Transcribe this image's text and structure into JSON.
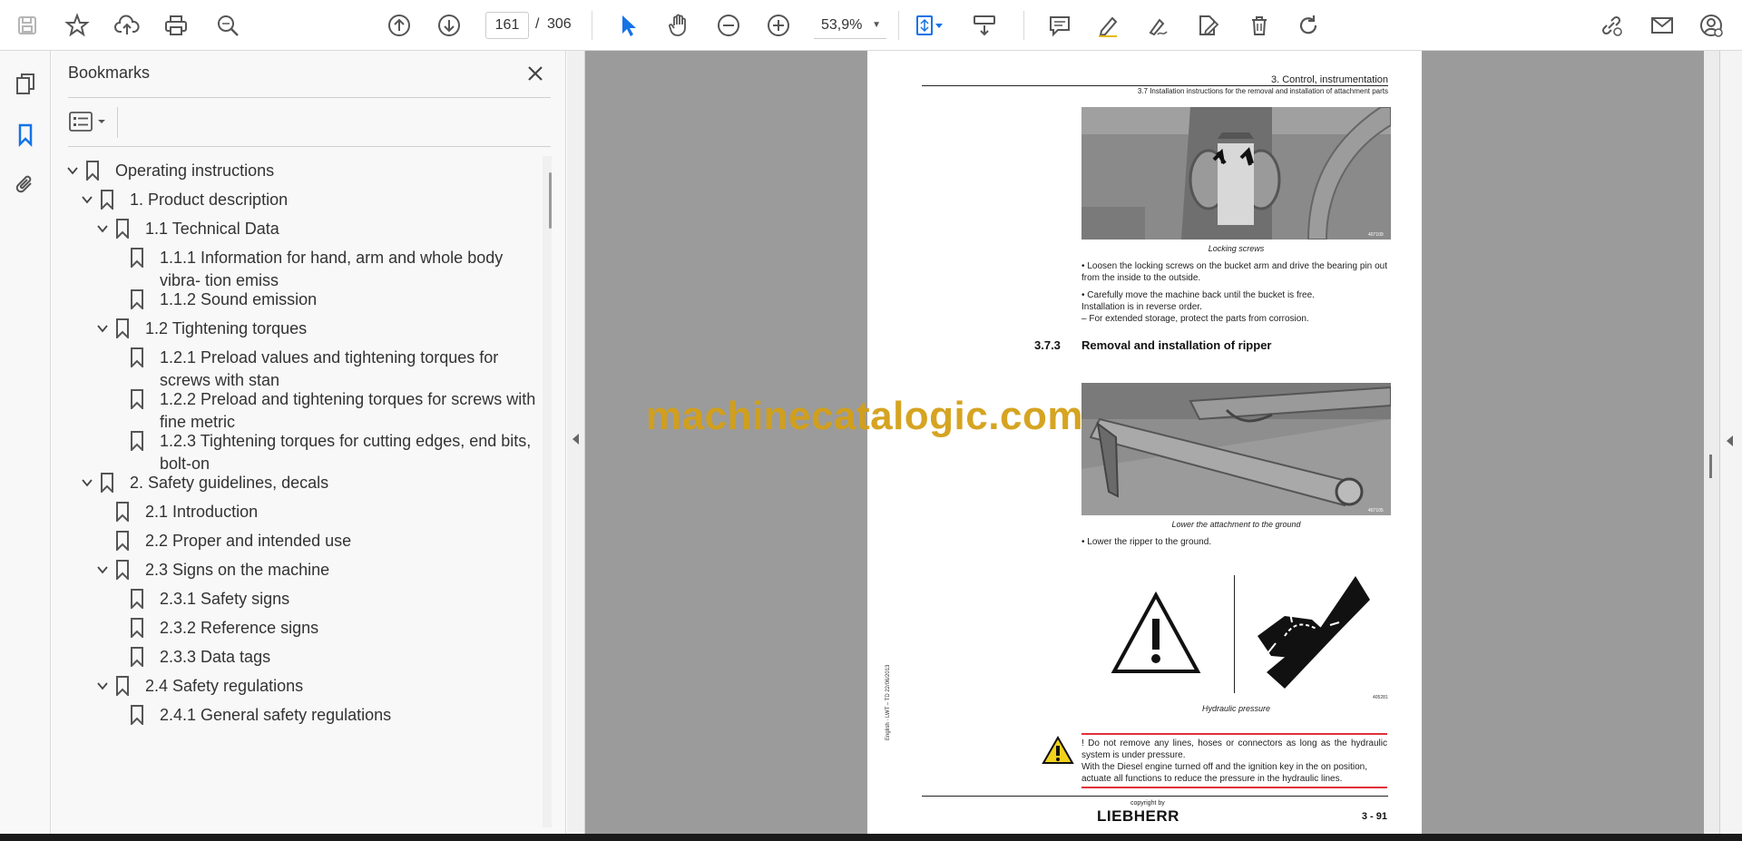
{
  "toolbar": {
    "page_current": "161",
    "page_separator": "/",
    "page_total": "306",
    "zoom": "53,9%"
  },
  "bookmarks_panel": {
    "title": "Bookmarks",
    "items": [
      {
        "label": "Operating instructions",
        "level": 0,
        "expanded": true
      },
      {
        "label": "1. Product description",
        "level": 1,
        "expanded": true
      },
      {
        "label": "1.1 Technical Data",
        "level": 2,
        "expanded": true
      },
      {
        "label": "1.1.1 Information for hand, arm and whole body vibra- tion emiss",
        "level": 3
      },
      {
        "label": "1.1.2 Sound emission",
        "level": 3
      },
      {
        "label": "1.2 Tightening torques",
        "level": 2,
        "expanded": true
      },
      {
        "label": "1.2.1 Preload values and tightening torques for screws with stan",
        "level": 3
      },
      {
        "label": "1.2.2 Preload and tightening torques for screws with fine metric",
        "level": 3
      },
      {
        "label": "1.2.3 Tightening torques for cutting edges, end bits, bolt-on",
        "level": 3
      },
      {
        "label": "2. Safety guidelines, decals",
        "level": 1,
        "expanded": true
      },
      {
        "label": "2.1 Introduction",
        "level": 2
      },
      {
        "label": "2.2 Proper and intended use",
        "level": 2
      },
      {
        "label": "2.3 Signs on the machine",
        "level": 2,
        "expanded": true
      },
      {
        "label": "2.3.1 Safety signs",
        "level": 3
      },
      {
        "label": "2.3.2 Reference signs",
        "level": 3
      },
      {
        "label": "2.3.3 Data tags",
        "level": 3
      },
      {
        "label": "2.4 Safety regulations",
        "level": 2,
        "expanded": true
      },
      {
        "label": "2.4.1 General safety regulations",
        "level": 3
      }
    ]
  },
  "document": {
    "header_chapter": "3. Control, instrumentation",
    "header_section": "3.7 Installation instructions for the removal and installation of attachment parts",
    "photo1_id": "407109",
    "photo1_caption": "Locking screws",
    "text1": "• Loosen the locking screws on the bucket arm and drive the bearing pin out from the inside to the outside.",
    "text2": "• Carefully move the machine back until the bucket is free.",
    "text3": "Installation is in reverse order.",
    "text4": "– For extended storage, protect the parts from corrosion.",
    "section_number": "3.7.3",
    "section_title": "Removal and installation of ripper",
    "photo2_id": "407105",
    "photo2_caption": "Lower the attachment to the ground",
    "text5": "• Lower the ripper to the ground.",
    "symbol_id": "405281",
    "symbol_caption": "Hydraulic pressure",
    "warning1": "! Do not remove any lines, hoses or connectors as long as the hydraulic system is under pressure.",
    "warning2": "With the Diesel engine turned off and the ignition key in the on position, actuate all functions to reduce the pressure in the hydraulic lines.",
    "side_text": "English · LWT – TD 22/06/2013",
    "copyright": "copyright by",
    "brand": "LIEBHERR",
    "page_number": "3 - 91"
  },
  "watermark": "machinecatalogic.com"
}
